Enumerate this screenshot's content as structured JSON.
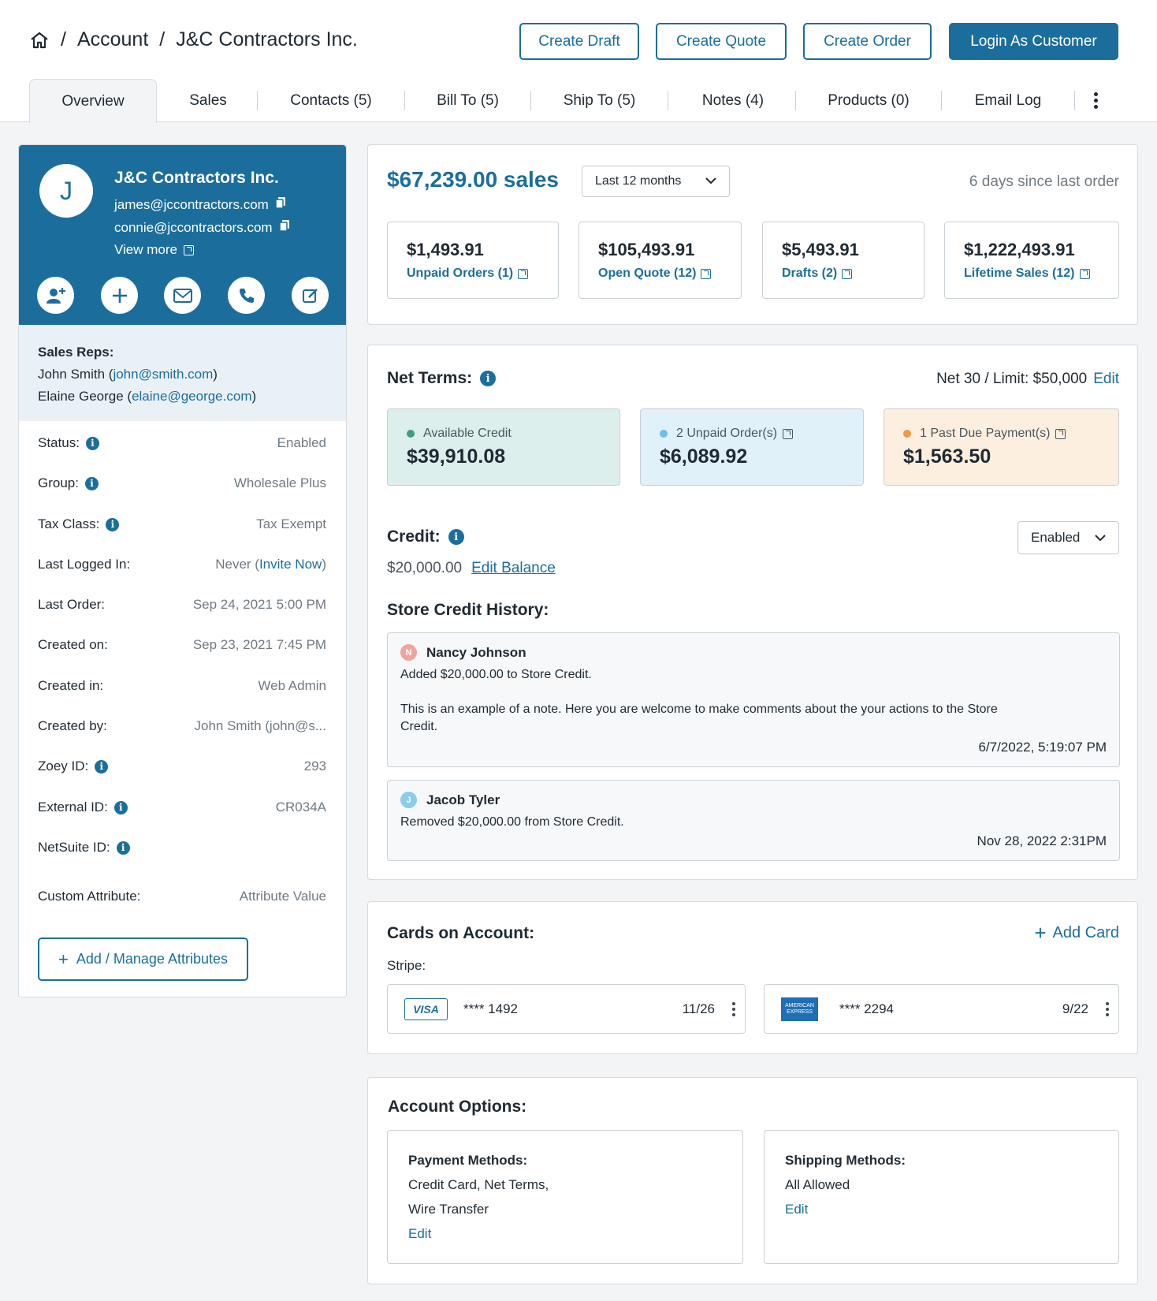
{
  "breadcrumb": {
    "sep1": "/",
    "account": "Account",
    "sep2": "/",
    "customer": "J&C Contractors Inc."
  },
  "header_buttons": {
    "create_draft": "Create Draft",
    "create_quote": "Create Quote",
    "create_order": "Create Order",
    "login_as_customer": "Login As Customer"
  },
  "tabs": [
    "Overview",
    "Sales",
    "Contacts (5)",
    "Bill To (5)",
    "Ship To (5)",
    "Notes (4)",
    "Products (0)",
    "Email Log"
  ],
  "profile": {
    "initial": "J",
    "name": "J&C Contractors Inc.",
    "emails": [
      "james@jccontractors.com",
      "connie@jccontractors.com"
    ],
    "view_more": "View more"
  },
  "sales_reps": {
    "title": "Sales Reps:",
    "reps": [
      {
        "name": "John Smith (",
        "email": "john@smith.com",
        "close": ")"
      },
      {
        "name": "Elaine George (",
        "email": "elaine@george.com",
        "close": ")"
      }
    ]
  },
  "details": [
    {
      "label": "Status:",
      "value": "Enabled"
    },
    {
      "label": "Group:",
      "value": "Wholesale Plus"
    },
    {
      "label": "Tax Class:",
      "value": "Tax Exempt"
    },
    {
      "label": "Last Logged In:",
      "value": "Never (",
      "link": "Invite Now",
      "close": ")"
    },
    {
      "label": "Last Order:",
      "value": "Sep 24, 2021 5:00 PM"
    },
    {
      "label": "Created on:",
      "value": "Sep 23, 2021 7:45 PM"
    },
    {
      "label": "Created in:",
      "value": "Web Admin"
    },
    {
      "label": "Created by:",
      "value": "John Smith (john@s..."
    },
    {
      "label": "Zoey ID:",
      "value": "293"
    },
    {
      "label": "External ID:",
      "value": "CR034A"
    },
    {
      "label": "NetSuite ID:",
      "value": ""
    },
    {
      "label": "Custom Attribute:",
      "value": "Attribute Value"
    }
  ],
  "add_attributes": "Add / Manage Attributes",
  "sales": {
    "amount": "$67,239.00 sales",
    "period": "Last 12 months",
    "since": "6 days since last order",
    "stats": [
      {
        "value": "$1,493.91",
        "label": "Unpaid Orders (1)"
      },
      {
        "value": "$105,493.91",
        "label": "Open Quote (12)"
      },
      {
        "value": "$5,493.91",
        "label": "Drafts (2)"
      },
      {
        "value": "$1,222,493.91",
        "label": "Lifetime Sales (12)"
      }
    ]
  },
  "net_terms": {
    "title": "Net Terms:",
    "summary": "Net 30 / Limit: $50,000",
    "edit": "Edit",
    "boxes": [
      {
        "label": "Available Credit",
        "value": "$39,910.08",
        "bg": "#dcefec",
        "dot": "#3f9d83"
      },
      {
        "label": "2 Unpaid Order(s)",
        "value": "$6,089.92",
        "bg": "#e1f1f9",
        "dot": "#6cc0e5"
      },
      {
        "label": "1 Past Due Payment(s)",
        "value": "$1,563.50",
        "bg": "#fcefdf",
        "dot": "#ef9a3b"
      }
    ]
  },
  "credit": {
    "title": "Credit:",
    "status": "Enabled",
    "balance": "$20,000.00",
    "edit_balance": "Edit Balance",
    "history_title": "Store Credit History:",
    "history": [
      {
        "initial": "N",
        "color": "#f0a59c",
        "name": "Nancy Johnson",
        "action": "Added $20,000.00 to Store Credit.",
        "note": "This is an example of a note. Here you are welcome to make comments about the your actions to the Store Credit.",
        "time": "6/7/2022, 5:19:07 PM"
      },
      {
        "initial": "J",
        "color": "#8ccbec",
        "name": "Jacob Tyler",
        "action": "Removed $20,000.00 from Store Credit.",
        "note": "",
        "time": "Nov 28, 2022 2:31PM"
      }
    ]
  },
  "cards": {
    "title": "Cards on Account:",
    "add": "Add Card",
    "provider": "Stripe:",
    "items": [
      {
        "brand": "VISA",
        "number": "**** 1492",
        "exp": "11/26"
      },
      {
        "brand": "AMERICAN EXPRESS",
        "number": "**** 2294",
        "exp": "9/22"
      }
    ]
  },
  "account_options": {
    "title": "Account Options:",
    "payment": {
      "title": "Payment Methods:",
      "line1": "Credit Card, Net Terms,",
      "line2": "Wire Transfer",
      "edit": "Edit"
    },
    "shipping": {
      "title": "Shipping Methods:",
      "line1": "All Allowed",
      "edit": "Edit"
    }
  },
  "colors": {
    "brand": "#1b6e9c",
    "background": "#f2f4f6"
  }
}
